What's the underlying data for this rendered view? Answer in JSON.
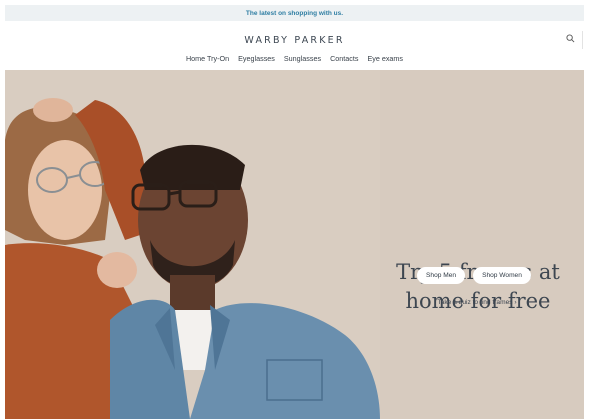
{
  "promo": {
    "text": "The latest on shopping with us."
  },
  "header": {
    "brand": "WARBY PARKER",
    "search_icon": "search-icon"
  },
  "nav": {
    "items": [
      "Home Try-On",
      "Eyeglasses",
      "Sunglasses",
      "Contacts",
      "Eye exams"
    ]
  },
  "hero": {
    "headline_line1": "Try 5 frames at",
    "headline_line2": "home for free",
    "cta_men": "Shop Men",
    "cta_women": "Shop Women",
    "quiz_link": "Take a quiz to find frames ›",
    "background_color": "#d7cbbf"
  }
}
